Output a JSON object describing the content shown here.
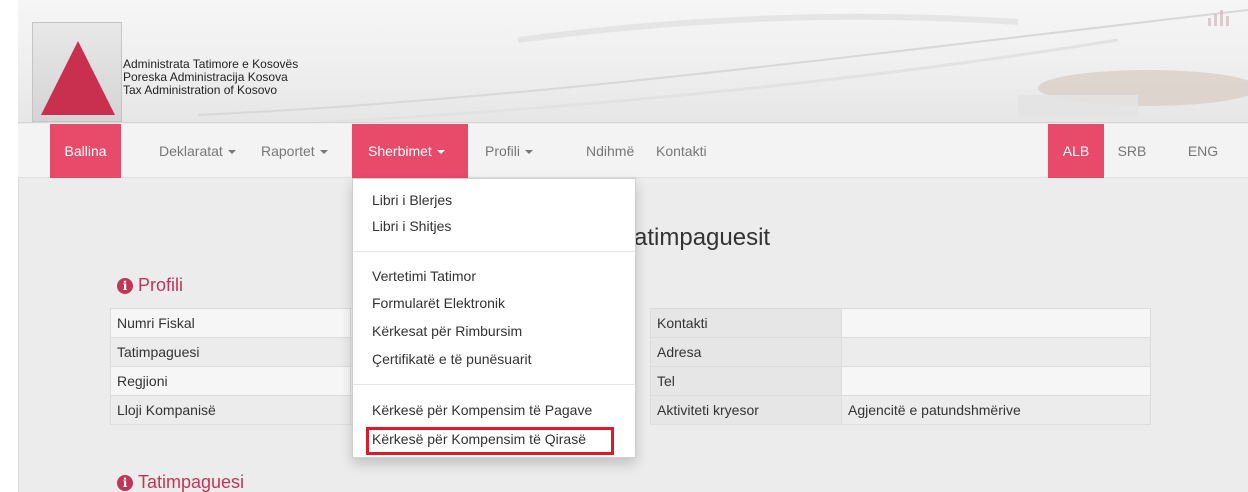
{
  "header": {
    "org_lines": [
      "Administrata Tatimore e Kosovës",
      "Poreska Administracija Kosova",
      "Tax Administration of Kosovo"
    ]
  },
  "nav": {
    "items": [
      {
        "label": "Ballina",
        "active": true
      },
      {
        "label": "Deklaratat",
        "has_caret": true
      },
      {
        "label": "Raportet",
        "has_caret": true
      },
      {
        "label": "Sherbimet",
        "has_caret": true,
        "open": true
      },
      {
        "label": "Profili",
        "has_caret": true
      },
      {
        "label": "Ndihmë"
      },
      {
        "label": "Kontakti"
      }
    ],
    "languages": [
      {
        "label": "ALB",
        "active": true
      },
      {
        "label": "SRB"
      },
      {
        "label": "ENG"
      }
    ]
  },
  "dropdown": {
    "items": [
      "Libri i Blerjes",
      "Libri i Shitjes",
      "Vertetimi Tatimor",
      "Formularët Elektronik",
      "Kërkesat për Rimbursim",
      "Çertifikatë e të punësuarit",
      "Kërkesë për Kompensim të Pagave",
      "Kërkesë për Kompensim të Qirasë"
    ],
    "highlighted_item": "Kërkesë për Kompensim të Qirasë"
  },
  "main": {
    "heading_visible": "atimpaguesit",
    "profile_section_title": "Profili",
    "taxpayer_section_title": "Tatimpaguesi",
    "left_table": [
      {
        "label": "Numri Fiskal",
        "value": ""
      },
      {
        "label": "Tatimpaguesi",
        "value": ""
      },
      {
        "label": "Regjioni",
        "value": ""
      },
      {
        "label": "Lloji Kompanisë",
        "value": ""
      }
    ],
    "right_table": [
      {
        "label": "Kontakti",
        "value": ""
      },
      {
        "label": "Adresa",
        "value": ""
      },
      {
        "label": "Tel",
        "value": ""
      },
      {
        "label": "Aktiviteti kryesor",
        "value": "Agjencitë e patundshmërive"
      }
    ]
  },
  "colors": {
    "accent": "#e84a6a",
    "section_title": "#c0365a",
    "highlight": "#e0192a"
  }
}
